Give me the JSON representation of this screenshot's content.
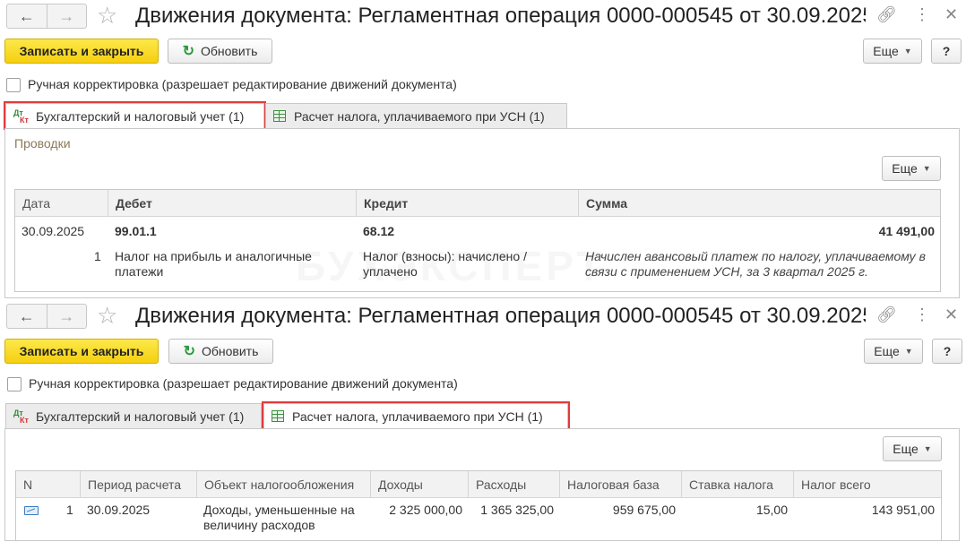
{
  "window1": {
    "title": "Движения документа: Регламентная операция 0000-000545 от 30.09.2025...",
    "toolbar": {
      "save_close": "Записать и закрыть",
      "refresh": "Обновить",
      "more": "Еще",
      "help": "?"
    },
    "manual_checkbox": {
      "label": "Ручная корректировка (разрешает редактирование движений документа)",
      "checked": false
    },
    "tabs": [
      {
        "label": "Бухгалтерский и налоговый учет (1)",
        "active": true,
        "icon": "dt-kt-icon"
      },
      {
        "label": "Расчет налога, уплачиваемого при УСН (1)",
        "active": false,
        "icon": "grid-icon"
      }
    ],
    "section_label": "Проводки",
    "more": "Еще",
    "table": {
      "headers": [
        "Дата",
        "Дебет",
        "Кредит",
        "Сумма"
      ],
      "row": {
        "date": "30.09.2025",
        "num": "1",
        "debit_account": "99.01.1",
        "debit_desc": "Налог на прибыль и аналогичные платежи",
        "credit_account": "68.12",
        "credit_desc": "Налог (взносы): начислено / уплачено",
        "amount": "41 491,00",
        "content": "Начислен авансовый платеж по налогу, уплачиваемому в связи с применением УСН, за 3 квартал 2025 г."
      }
    }
  },
  "window2": {
    "title": "Движения документа: Регламентная операция 0000-000545 от 30.09.2025...",
    "toolbar": {
      "save_close": "Записать и закрыть",
      "refresh": "Обновить",
      "more": "Еще",
      "help": "?"
    },
    "manual_checkbox": {
      "label": "Ручная корректировка (разрешает редактирование движений документа)",
      "checked": false
    },
    "tabs": [
      {
        "label": "Бухгалтерский и налоговый учет (1)",
        "active": false,
        "icon": "dt-kt-icon"
      },
      {
        "label": "Расчет налога, уплачиваемого при УСН (1)",
        "active": true,
        "icon": "grid-icon"
      }
    ],
    "more": "Еще",
    "table": {
      "headers": [
        "N",
        "Период расчета",
        "Объект налогообложения",
        "Доходы",
        "Расходы",
        "Налоговая база",
        "Ставка налога",
        "Налог всего"
      ],
      "row": {
        "num": "1",
        "period": "30.09.2025",
        "object": "Доходы, уменьшенные на величину расходов",
        "income": "2 325 000,00",
        "expenses": "1 365 325,00",
        "base": "959 675,00",
        "rate": "15,00",
        "tax": "143 951,00"
      }
    }
  },
  "watermark": "БУХЭКСПЕРТ",
  "colors": {
    "primary_button": "#f5cf10",
    "highlight": "#e03c3c",
    "refresh_icon": "#2a9a3c"
  }
}
